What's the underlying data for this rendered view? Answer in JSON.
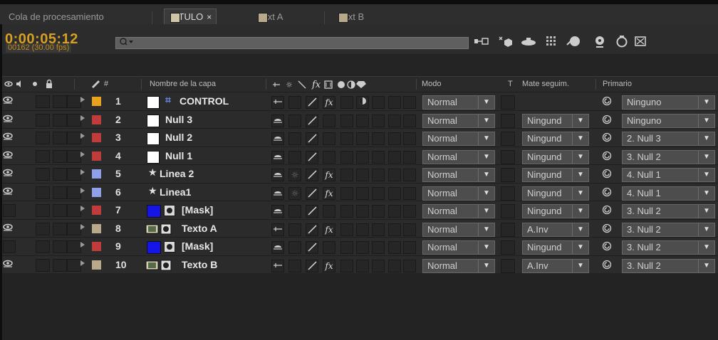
{
  "tabs": [
    {
      "label": "Cola de procesamiento",
      "color": null,
      "active": false
    },
    {
      "label": "TITULO",
      "color": "#cfc7a8",
      "active": true,
      "close": "×"
    },
    {
      "label": "Text A",
      "color": "#cfc7a8",
      "active": false
    },
    {
      "label": "Text B",
      "color": "#cfc7a8",
      "active": false
    }
  ],
  "timecode": "0:00:05:12",
  "frames_fps": "00162 (30.00 fps)",
  "search": {
    "placeholder": ""
  },
  "columns": {
    "name": "Nombre de la capa",
    "number": "#",
    "mode": "Modo",
    "t": "T",
    "mate": "Mate seguim.",
    "parent": "Primario"
  },
  "rows": [
    {
      "num": "1",
      "name": "CONTROL",
      "label_color": "#e8a21b",
      "icon": "hash",
      "visible": true,
      "mode": "Normal",
      "mate": "",
      "parent": "Ninguno",
      "fx": true
    },
    {
      "num": "2",
      "name": "Null 3",
      "label_color": "#c23b3b",
      "icon": "white",
      "visible": true,
      "mode": "Normal",
      "mate": "Ningund",
      "parent": "Ninguno",
      "fx": false
    },
    {
      "num": "3",
      "name": "Null 2",
      "label_color": "#c23b3b",
      "icon": "white",
      "visible": true,
      "mode": "Normal",
      "mate": "Ningund",
      "parent": "2. Null 3",
      "fx": false
    },
    {
      "num": "4",
      "name": "Null 1",
      "label_color": "#c23b3b",
      "icon": "white",
      "visible": true,
      "mode": "Normal",
      "mate": "Ningund",
      "parent": "3. Null 2",
      "fx": false
    },
    {
      "num": "5",
      "name": "Linea 2",
      "label_color": "#8fa0e8",
      "icon": "star",
      "visible": true,
      "mode": "Normal",
      "mate": "Ningund",
      "parent": "4. Null 1",
      "fx": true
    },
    {
      "num": "6",
      "name": "Linea1",
      "label_color": "#8fa0e8",
      "icon": "star",
      "visible": true,
      "mode": "Normal",
      "mate": "Ningund",
      "parent": "4. Null 1",
      "fx": true
    },
    {
      "num": "7",
      "name": "[Mask]",
      "label_color": "#c23b3b",
      "icon": "blue",
      "visible": false,
      "mode": "Normal",
      "mate": "Ningund",
      "parent": "3. Null 2",
      "fx": false
    },
    {
      "num": "8",
      "name": "Texto A",
      "label_color": "#b8a98a",
      "icon": "comp",
      "visible": true,
      "mode": "Normal",
      "mate": "A.Inv",
      "parent": "3. Null 2",
      "fx": true
    },
    {
      "num": "9",
      "name": "[Mask]",
      "label_color": "#c23b3b",
      "icon": "blue",
      "visible": false,
      "mode": "Normal",
      "mate": "Ningund",
      "parent": "3. Null 2",
      "fx": false
    },
    {
      "num": "10",
      "name": "Texto B",
      "label_color": "#b8a98a",
      "icon": "comp",
      "visible": true,
      "mode": "Normal",
      "mate": "A.Inv",
      "parent": "3. Null 2",
      "fx": true
    }
  ],
  "glyphs": {
    "eye": "👁",
    "dropdown": "▼",
    "fx": "fx",
    "star": "★",
    "hash": "⌗",
    "spiral": "@"
  }
}
